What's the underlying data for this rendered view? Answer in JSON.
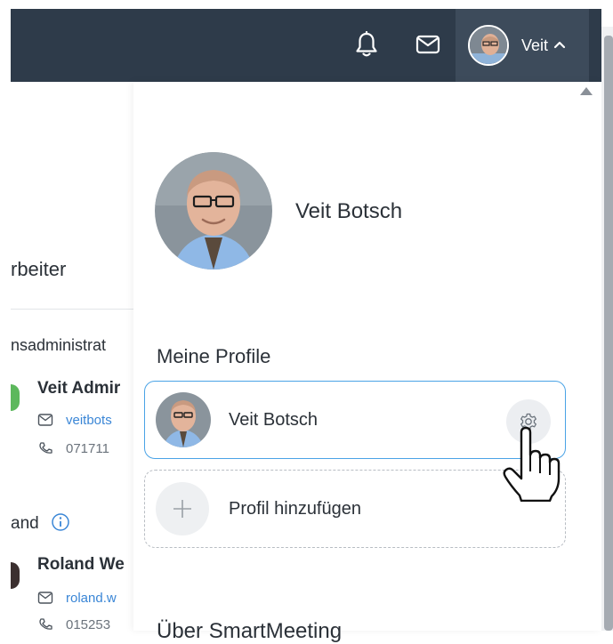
{
  "header": {
    "user_short_name": "Veit",
    "icons": [
      "bell-icon",
      "mail-icon",
      "chevron-up-icon"
    ]
  },
  "background_page": {
    "section_title": "rbeiter",
    "group_title": "nsadministrat",
    "group2_title": "and",
    "person1": {
      "name": "Veit Admir",
      "email": "veitbots",
      "phone": "071711"
    },
    "person2": {
      "name": "Roland We",
      "email": "roland.w",
      "phone": "015253"
    }
  },
  "dropdown": {
    "profile_name": "Veit Botsch",
    "section_heading": "Meine Profile",
    "profiles": [
      {
        "name": "Veit Botsch"
      }
    ],
    "add_profile_label": "Profil hinzufügen",
    "cut_heading": "Über SmartMeeting"
  },
  "colors": {
    "navbar": "#2e3b4a",
    "user_menu": "#3d4b5b",
    "accent_border": "#4aa3e6",
    "link": "#3a86d6"
  }
}
